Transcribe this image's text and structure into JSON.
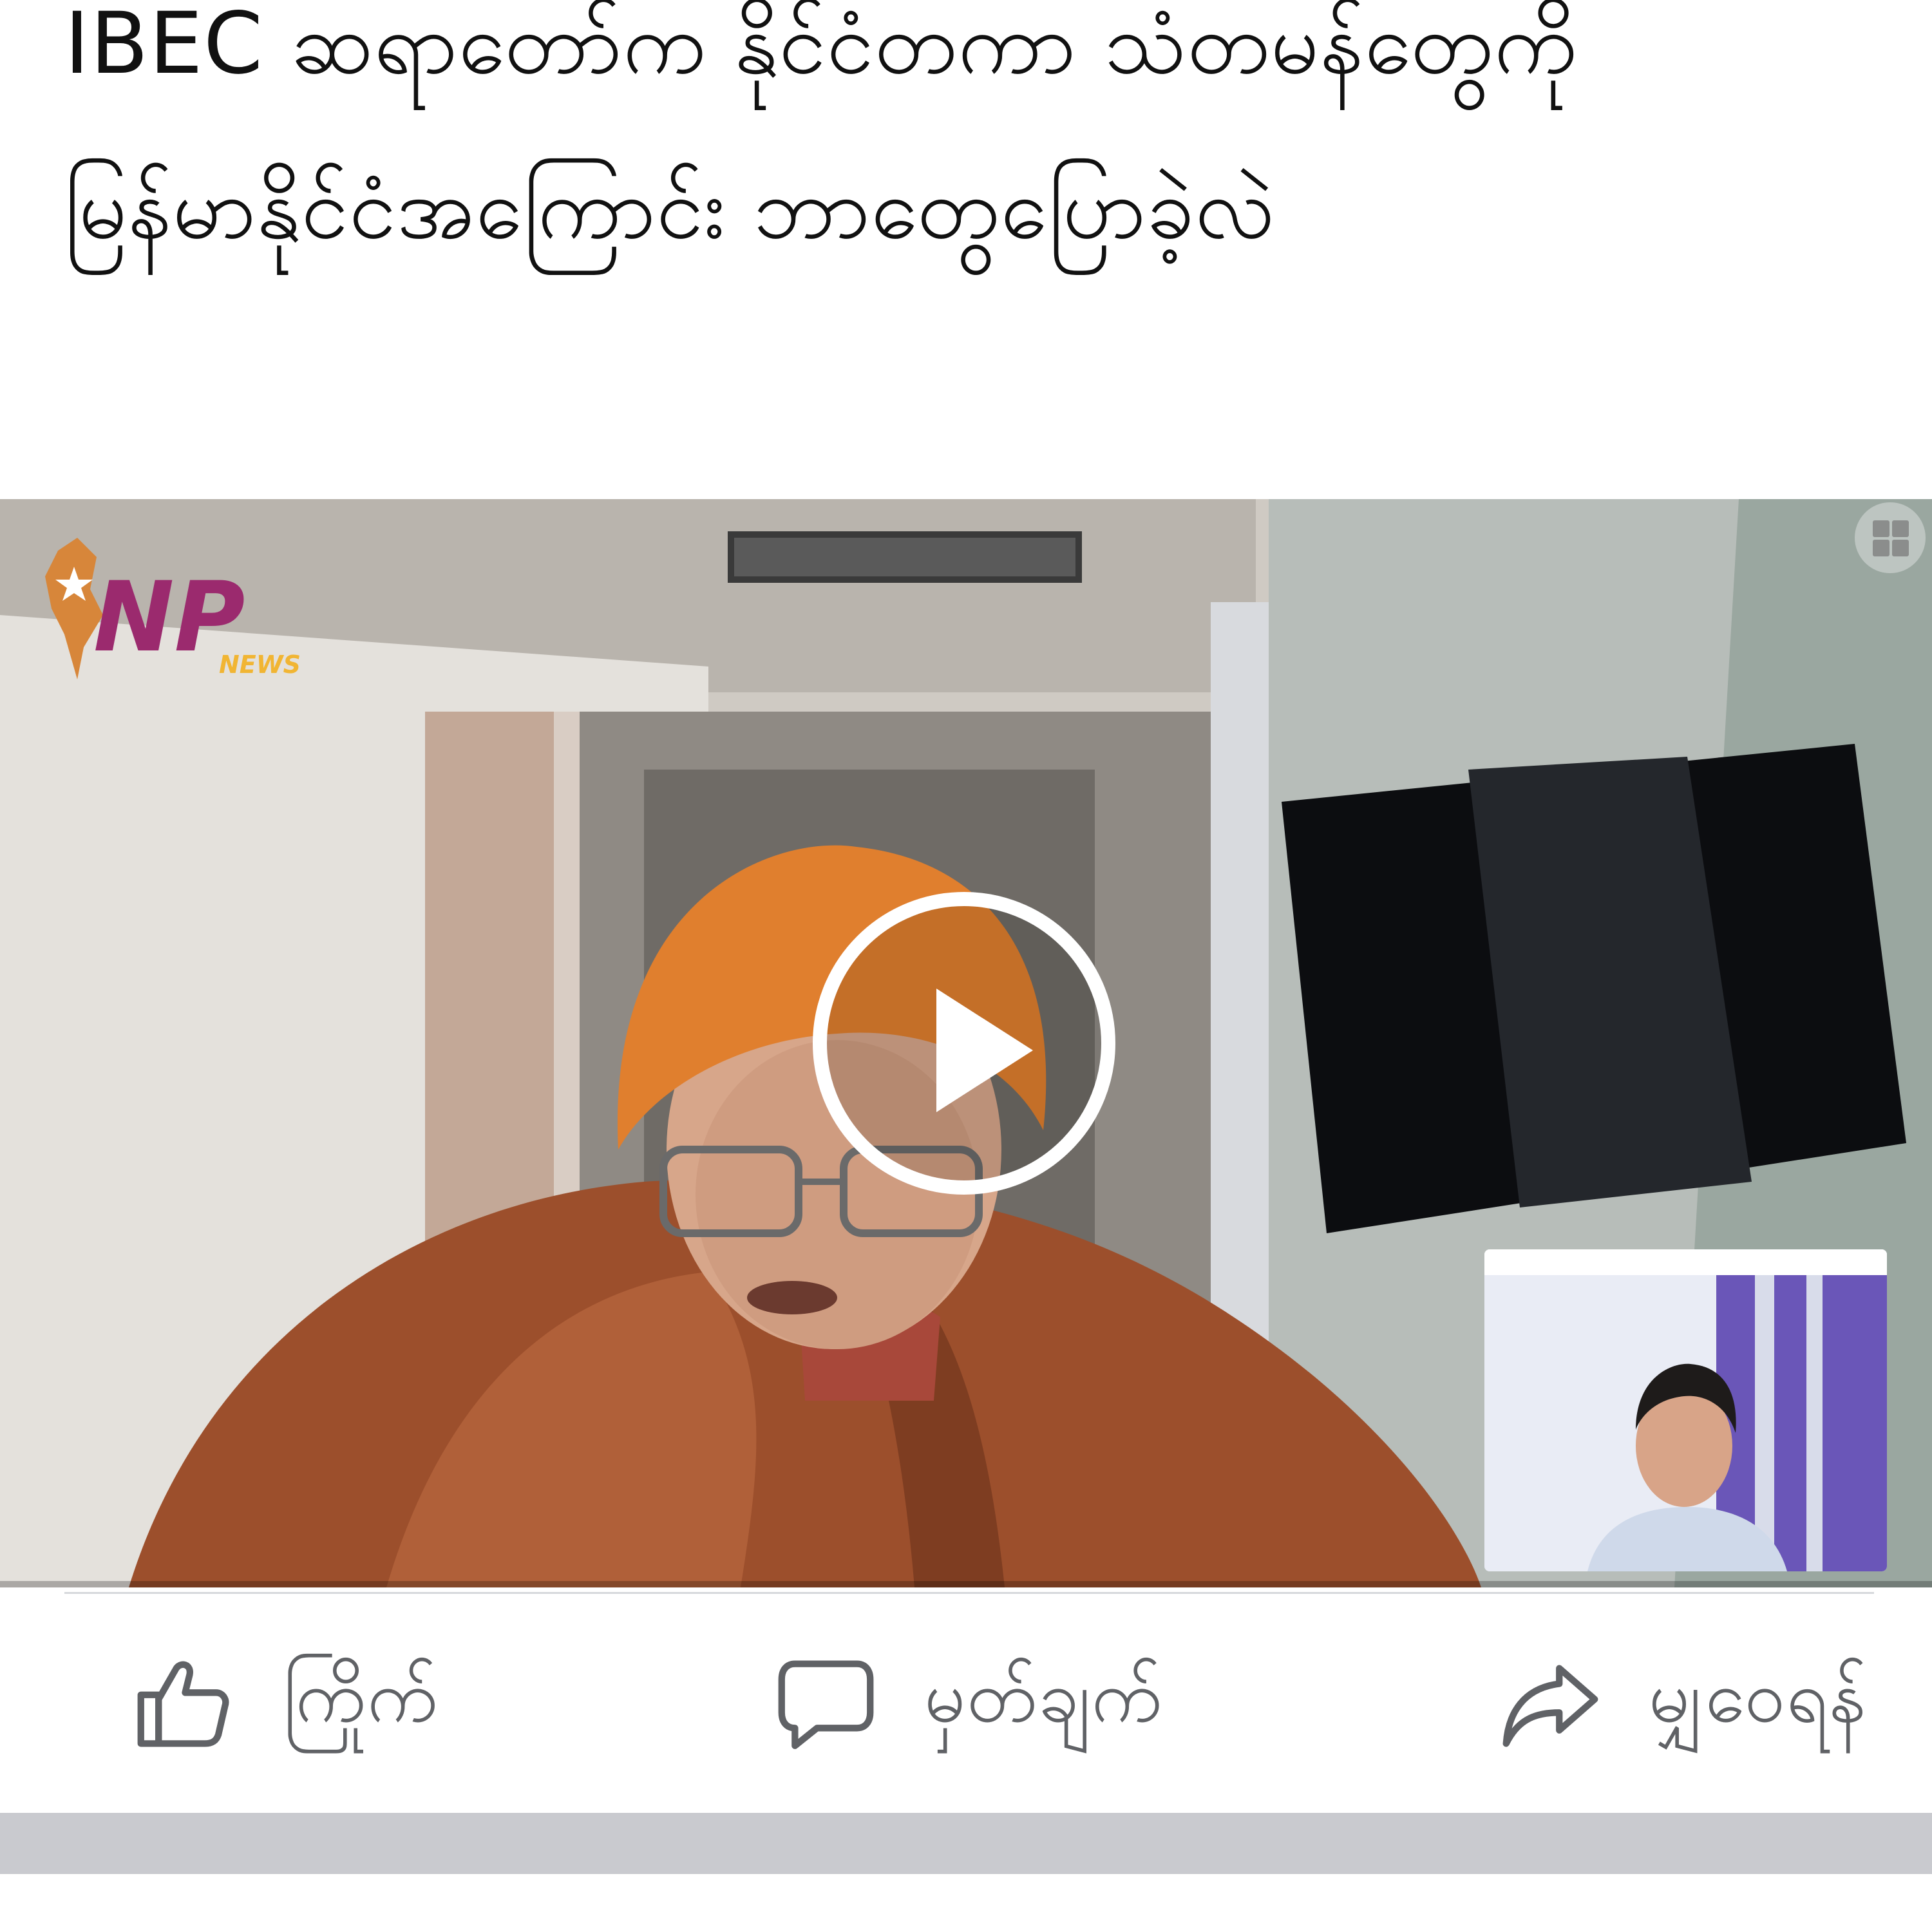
{
  "post": {
    "title": "IBEC ဆရာတော်က နိုင်ငံတကာ သံတမန်တွေကို မြန်မာနိုင်ငံအကြောင်း ဘာတွေပြောခဲ့လဲ"
  },
  "video": {
    "channel_logo_text": "NP",
    "channel_logo_subtext": "NEWS",
    "progress": 0.0
  },
  "actions": {
    "like_label": "ကြိုက်",
    "comment_label": "မှတ်ချက်",
    "share_label": "မျှဝေရန်"
  },
  "colors": {
    "logo_magenta": "#9b2a6e",
    "logo_gold": "#f1b533",
    "action_gray": "#606266",
    "band_gray": "#c9cacf"
  }
}
